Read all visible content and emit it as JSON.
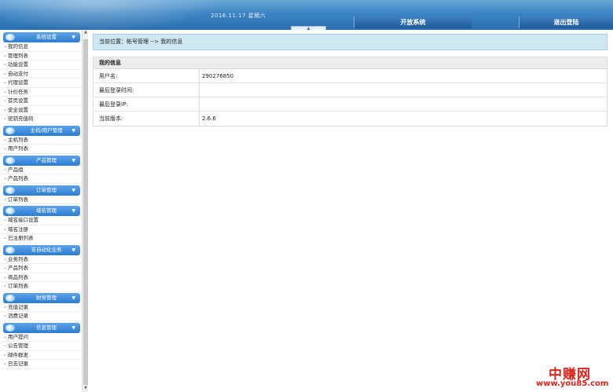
{
  "header": {
    "date": "2016.11.17 星期六",
    "open_system": "开放系统",
    "logout": "退出登陆",
    "toggle_glyph": "▲"
  },
  "sidebar": {
    "groups": [
      {
        "title": "系统设置",
        "items": [
          "我的信息",
          "管理列表",
          "功能设置",
          "自动支付",
          "代理设置",
          "计价任务",
          "首页设置",
          "安全设置",
          "密钥充值码"
        ]
      },
      {
        "title": "主机/用户管理",
        "items": [
          "主机列表",
          "用户列表"
        ]
      },
      {
        "title": "产品管理",
        "items": [
          "产品组",
          "产品列表"
        ]
      },
      {
        "title": "订单管理",
        "items": [
          "订单列表"
        ]
      },
      {
        "title": "域名管理",
        "items": [
          "域名接口设置",
          "域名注册",
          "已注册列表"
        ]
      },
      {
        "title": "非自动化业务",
        "items": [
          "业务列表",
          "产品列表",
          "商品列表",
          "订单列表"
        ]
      },
      {
        "title": "财务管理",
        "items": [
          "充值记录",
          "消费记录"
        ]
      },
      {
        "title": "信息管理",
        "items": [
          "用户提问",
          "公告管理",
          "邮件群发",
          "日志记录"
        ]
      }
    ],
    "chevron": "▼"
  },
  "main": {
    "breadcrumb": "当前位置：帐号管理 --> 我的信息",
    "panel_title": "我的信息",
    "rows": [
      {
        "label": "用户名:",
        "value": "290276850"
      },
      {
        "label": "最后登录时间:",
        "value": ""
      },
      {
        "label": "最后登录IP:",
        "value": ""
      },
      {
        "label": "当前版本:",
        "value": "2.6.6"
      }
    ]
  },
  "watermark": {
    "cn": "中赚网",
    "url": "www.you85.com"
  },
  "colors": {
    "topbar": "#2a6fb0",
    "accent": "#2d7cd0",
    "breadcrumb_bg": "#cfe7f3",
    "watermark": "#e0221a"
  }
}
